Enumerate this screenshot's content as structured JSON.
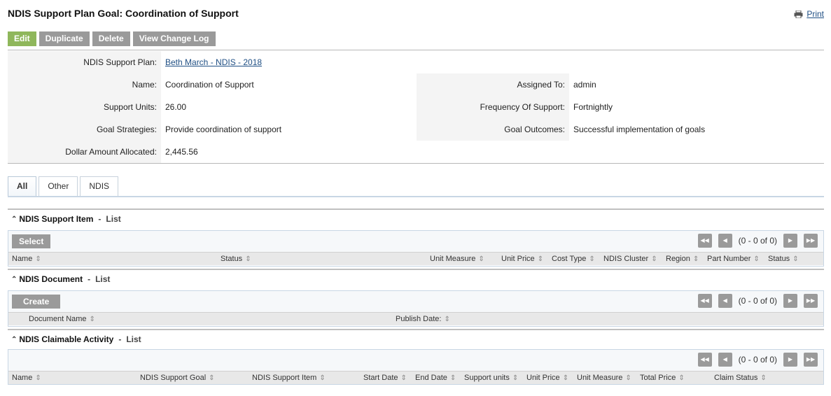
{
  "page": {
    "title": "NDIS Support Plan Goal: Coordination of Support",
    "print_label": "Print",
    "print_icon": "printer-icon"
  },
  "toolbar": {
    "edit": "Edit",
    "duplicate": "Duplicate",
    "delete": "Delete",
    "change_log": "View Change Log"
  },
  "details": {
    "support_plan_label": "NDIS Support Plan:",
    "support_plan_value": "Beth March - NDIS - 2018",
    "name_label": "Name:",
    "name_value": "Coordination of Support",
    "assigned_label": "Assigned To:",
    "assigned_value": "admin",
    "units_label": "Support Units:",
    "units_value": "26.00",
    "frequency_label": "Frequency Of Support:",
    "frequency_value": "Fortnightly",
    "strategies_label": "Goal Strategies:",
    "strategies_value": "Provide coordination of support",
    "outcomes_label": "Goal Outcomes:",
    "outcomes_value": "Successful implementation of goals",
    "dollar_label": "Dollar Amount Allocated:",
    "dollar_value": "2,445.56"
  },
  "tabs": [
    "All",
    "Other",
    "NDIS"
  ],
  "sections": {
    "support_item": {
      "title": "NDIS Support Item",
      "sep": "-",
      "list": "List",
      "button": "Select",
      "count": "(0 - 0 of 0)",
      "columns": [
        "Name",
        "Status",
        "Unit Measure",
        "Unit Price",
        "Cost Type",
        "NDIS Cluster",
        "Region",
        "Part Number",
        "Status"
      ]
    },
    "document": {
      "title": "NDIS Document",
      "sep": "-",
      "list": "List",
      "button": "Create",
      "count": "(0 - 0 of 0)",
      "columns": [
        "Document Name",
        "Publish Date:"
      ]
    },
    "claimable": {
      "title": "NDIS Claimable Activity",
      "sep": "-",
      "list": "List",
      "count": "(0 - 0 of 0)",
      "columns": [
        "Name",
        "NDIS Support Goal",
        "NDIS Support Item",
        "Start Date",
        "End Date",
        "Support units",
        "Unit Price",
        "Unit Measure",
        "Total Price",
        "Claim Status"
      ]
    }
  },
  "colors": {
    "edit_button": "#8fb75b",
    "gray_button": "#9a9a9a",
    "link": "#1f4f84"
  }
}
